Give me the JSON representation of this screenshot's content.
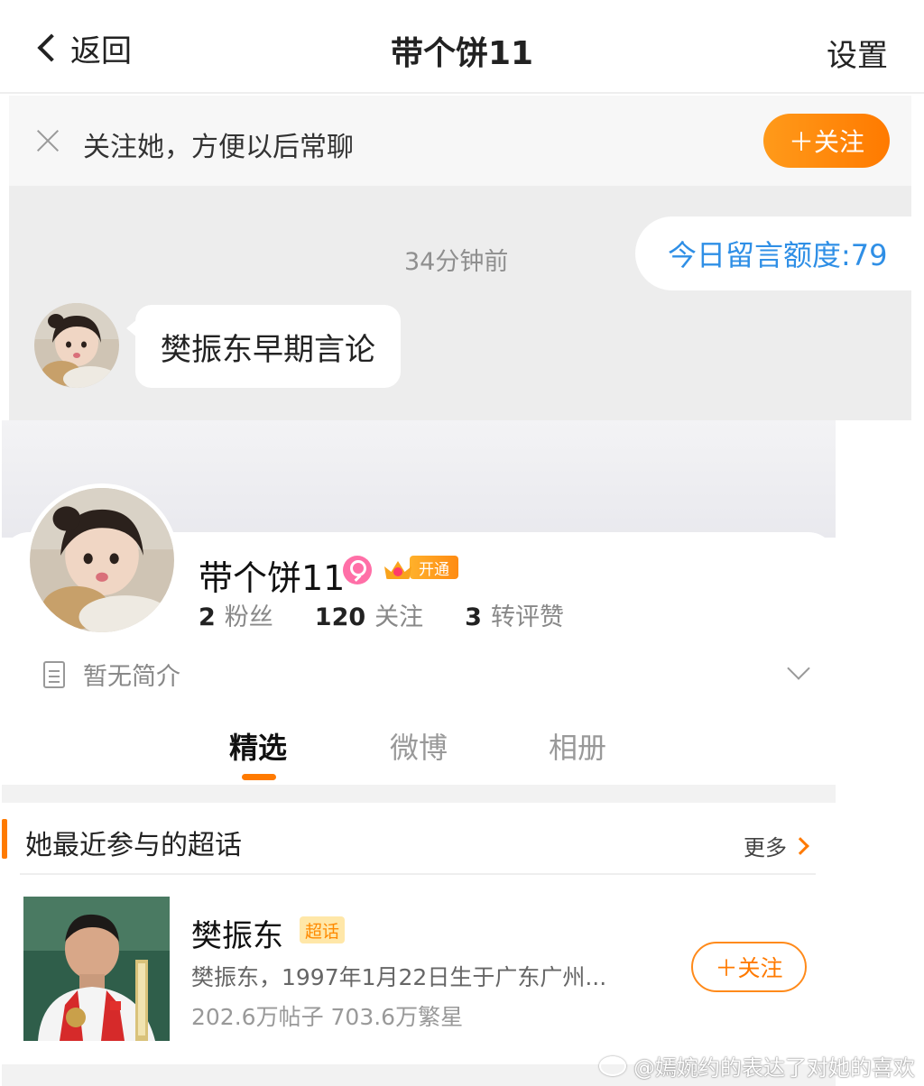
{
  "navbar": {
    "back_label": "返回",
    "title": "带个饼11",
    "settings_label": "设置"
  },
  "follow_banner": {
    "text": "关注她，方便以后常聊",
    "button_label": "＋关注"
  },
  "chat": {
    "timestamp": "34分钟前",
    "quota_text": "今日留言额度:79",
    "message": "樊振东早期言论"
  },
  "profile": {
    "name": "带个饼11",
    "vip_label": "开通",
    "stats": [
      {
        "count": "2",
        "label": "粉丝"
      },
      {
        "count": "120",
        "label": "关注"
      },
      {
        "count": "3",
        "label": "转评赞"
      }
    ],
    "bio": "暂无简介",
    "tabs": [
      "精选",
      "微博",
      "相册"
    ],
    "active_tab": "精选"
  },
  "supertopic": {
    "section_title": "她最近参与的超话",
    "more_label": "更多",
    "item": {
      "name": "樊振东",
      "tag": "超话",
      "description": "樊振东，1997年1月22日生于广东广州...",
      "stats": "202.6万帖子 703.6万繁星",
      "follow_label": "＋关注"
    }
  },
  "watermark": "@嫣婉约的表达了对她的喜欢",
  "colors": {
    "accent_orange": "#ff7a00",
    "link_blue": "#2f8fe6",
    "chat_bg": "#ededed"
  }
}
